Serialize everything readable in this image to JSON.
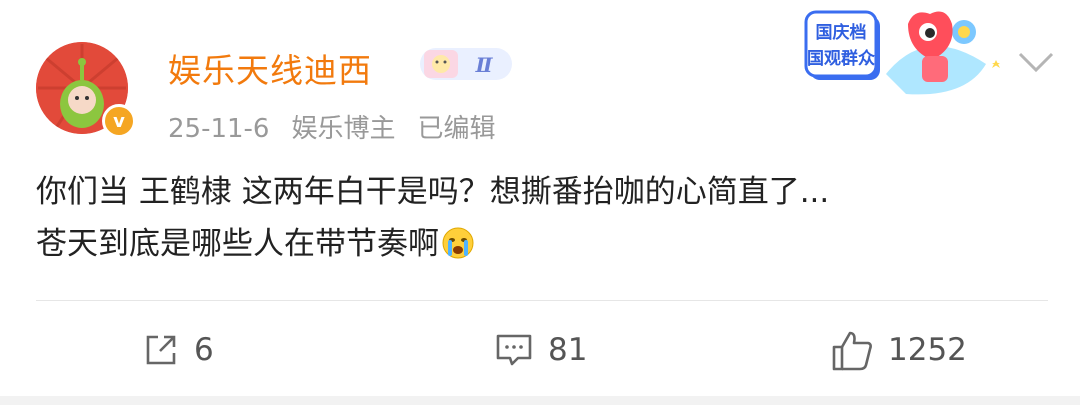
{
  "post": {
    "author": "娱乐天线迪西",
    "level_badge": "Ⅱ",
    "verified_mark": "v",
    "date": "25-11-6",
    "category": "娱乐博主",
    "edited": "已编辑",
    "text_line1": "你们当 王鹤棣 这两年白干是吗？想撕番抬咖的心简直了...",
    "text_line2": "苍天到底是哪些人在带节奏啊",
    "emoji": "crying-face-icon"
  },
  "promo": {
    "line1": "国庆档",
    "line2": "国观群众"
  },
  "actions": {
    "share_count": "6",
    "comment_count": "81",
    "like_count": "1252"
  },
  "colors": {
    "author": "#f27a0d",
    "meta": "#999999",
    "text": "#222222",
    "verified": "#f5a623"
  }
}
